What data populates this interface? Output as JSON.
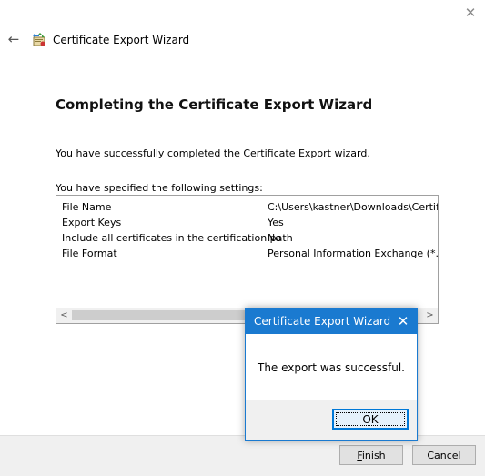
{
  "window": {
    "close_glyph": "✕",
    "back_glyph": "←",
    "title": "Certificate Export Wizard"
  },
  "page": {
    "heading": "Completing the Certificate Export Wizard",
    "success_text": "You have successfully completed the Certificate Export wizard.",
    "settings_intro": "You have specified the following settings:"
  },
  "settings": {
    "rows": [
      {
        "key": "File Name",
        "value": "C:\\Users\\kastner\\Downloads\\Certificat"
      },
      {
        "key": "Export Keys",
        "value": "Yes"
      },
      {
        "key": "Include all certificates in the certification path",
        "value": "No"
      },
      {
        "key": "File Format",
        "value": "Personal Information Exchange (*.pfx)"
      }
    ],
    "scroll_left_glyph": "<",
    "scroll_right_glyph": ">"
  },
  "buttons": {
    "finish_label_first": "F",
    "finish_label_rest": "inish",
    "cancel_label": "Cancel"
  },
  "message_box": {
    "title": "Certificate Export Wizard",
    "close_glyph": "✕",
    "text": "The export was successful.",
    "ok_label": "OK",
    "accent_color": "#1a7ad0"
  },
  "icons": [
    "close-icon",
    "back-arrow-icon",
    "certificate-wizard-icon",
    "scroll-left-arrow-icon",
    "scroll-right-arrow-icon"
  ]
}
